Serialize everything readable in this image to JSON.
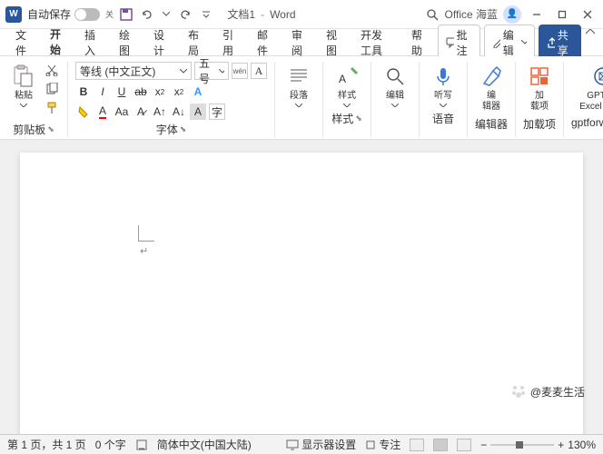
{
  "titlebar": {
    "app_initial": "W",
    "autosave_label": "自动保存",
    "autosave_state": "关",
    "doc_name": "文档1",
    "app_name": "Word",
    "user_name": "Office 海蓝"
  },
  "tabs": [
    "文件",
    "开始",
    "插入",
    "绘图",
    "设计",
    "布局",
    "引用",
    "邮件",
    "审阅",
    "视图",
    "开发工具",
    "帮助"
  ],
  "active_tab": "开始",
  "tab_actions": {
    "comments": "批注",
    "editing": "编辑",
    "share": "共享"
  },
  "ribbon": {
    "clipboard": {
      "label": "剪贴板",
      "paste": "粘贴"
    },
    "font": {
      "label": "字体",
      "name": "等线 (中文正文)",
      "size": "五号",
      "wen": "wén"
    },
    "paragraph": {
      "label": "段落"
    },
    "styles": {
      "label": "样式",
      "text": "样式"
    },
    "editing": {
      "label": "编辑",
      "text": "编辑"
    },
    "voice": {
      "label": "语音",
      "text": "听写"
    },
    "editor": {
      "label": "编辑器",
      "text": "编\n辑器"
    },
    "addins": {
      "label": "加载项",
      "text": "加\n载项"
    },
    "gpt": {
      "label": "gptforwork....",
      "text": "GPT for\nExcel Word"
    }
  },
  "status": {
    "page": "第 1 页，共 1 页",
    "words": "0 个字",
    "lang": "简体中文(中国大陆)",
    "display": "显示器设置",
    "focus": "专注",
    "zoom": "130%"
  },
  "watermark": "@麦麦生活"
}
